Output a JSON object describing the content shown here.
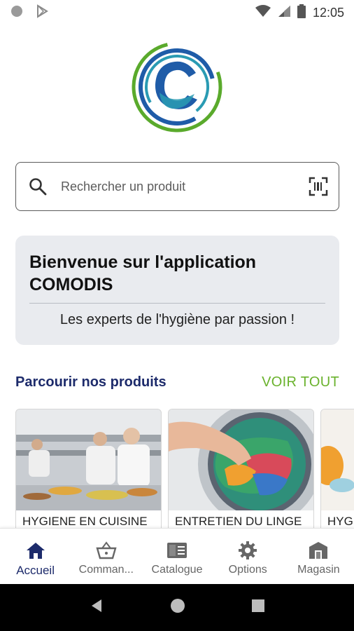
{
  "status_bar": {
    "time": "12:05",
    "left_icons": [
      "circle-dot-icon",
      "play-store-icon"
    ],
    "right_icons": [
      "wifi-icon",
      "signal-icon",
      "battery-icon"
    ]
  },
  "colors": {
    "brand_navy": "#1d2b6b",
    "brand_green": "#6ab22d",
    "panel_bg": "#e9ebef",
    "logo_blue": "#1f5ca8",
    "logo_teal": "#2a9bb3",
    "logo_green": "#5aaa2c"
  },
  "search": {
    "placeholder": "Rechercher un produit",
    "icon": "search-icon",
    "scan_icon": "barcode-scan-icon"
  },
  "welcome": {
    "title": "Bienvenue sur l'application COMODIS",
    "subtitle": "Les experts de l'hygiène par passion !"
  },
  "products": {
    "title": "Parcourir nos produits",
    "see_all": "VOIR TOUT",
    "items": [
      {
        "label": "HYGIENE EN CUISINE"
      },
      {
        "label": "ENTRETIEN DU LINGE"
      },
      {
        "label": "HYGIENE"
      }
    ]
  },
  "bottom_nav": {
    "items": [
      {
        "label": "Accueil",
        "icon": "home-icon",
        "active": true
      },
      {
        "label": "Comman...",
        "icon": "basket-icon",
        "active": false
      },
      {
        "label": "Catalogue",
        "icon": "catalog-icon",
        "active": false
      },
      {
        "label": "Options",
        "icon": "gear-icon",
        "active": false
      },
      {
        "label": "Magasin",
        "icon": "store-icon",
        "active": false
      }
    ]
  },
  "system_nav": {
    "icons": [
      "back-icon",
      "home-circle-icon",
      "recents-icon"
    ]
  }
}
